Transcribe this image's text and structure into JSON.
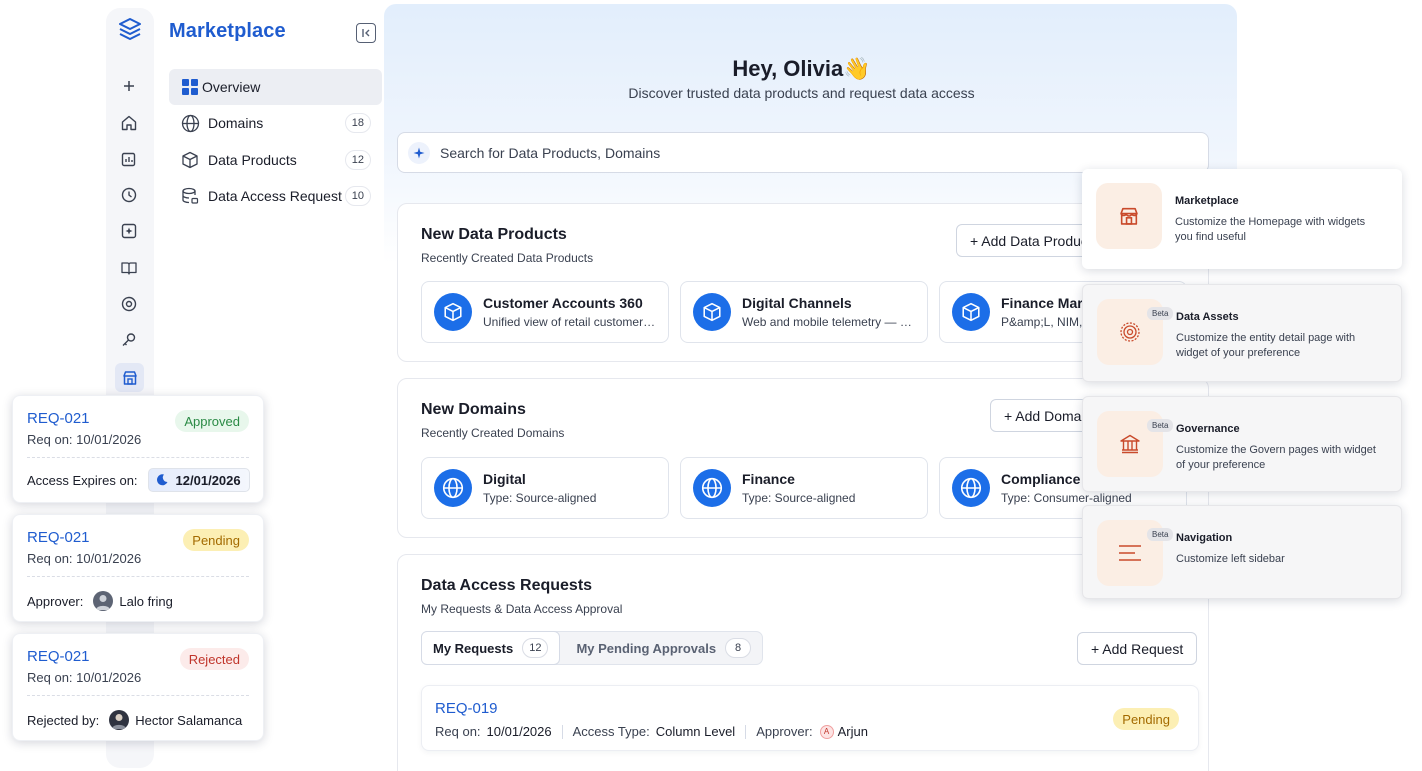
{
  "sidebar": {
    "title": "Marketplace",
    "items": [
      {
        "label": "Overview",
        "count": ""
      },
      {
        "label": "Domains",
        "count": "18"
      },
      {
        "label": "Data Products",
        "count": "12"
      },
      {
        "label": "Data Access Request",
        "count": "10"
      }
    ]
  },
  "rail_icons": [
    "add-icon",
    "home-icon",
    "insights-icon",
    "history-icon",
    "ai-icon",
    "glossary-icon",
    "governance-icon",
    "tools-icon",
    "marketplace-icon"
  ],
  "header": {
    "greeting": "Hey, Olivia",
    "wave": "👋",
    "subtitle": "Discover trusted data products and request data access"
  },
  "search": {
    "placeholder": "Search for Data Products, Domains"
  },
  "new_products": {
    "title": "New Data Products",
    "subtitle": "Recently Created Data Products",
    "button": "+ Add Data Products",
    "cards": [
      {
        "name": "Customer Accounts 360",
        "desc": "Unified view of retail customer accounts"
      },
      {
        "name": "Digital Channels",
        "desc": "Web and mobile telemetry — sessions"
      },
      {
        "name": "Finance Mart",
        "desc": "P&amp;L, NIM, fees"
      }
    ]
  },
  "new_domains": {
    "title": "New Domains",
    "subtitle": "Recently Created Domains",
    "button": "+ Add Domain",
    "cards": [
      {
        "name": "Digital",
        "desc": "Type: Source-aligned"
      },
      {
        "name": "Finance",
        "desc": "Type: Source-aligned"
      },
      {
        "name": "Compliance & Risk",
        "desc": "Type: Consumer-aligned"
      }
    ]
  },
  "access_requests": {
    "title": "Data Access Requests",
    "subtitle": "My Requests & Data Access Approval",
    "tabs": [
      {
        "label": "My Requests",
        "count": "12"
      },
      {
        "label": "My Pending Approvals",
        "count": "8"
      }
    ],
    "button": "+ Add Request",
    "row": {
      "id": "REQ-019",
      "req_on_label": "Req on:",
      "req_on": "10/01/2026",
      "access_type_label": "Access Type:",
      "access_type": "Column Level",
      "approver_label": "Approver:",
      "approver_initial": "A",
      "approver": "Arjun",
      "status": "Pending"
    }
  },
  "floating_requests": [
    {
      "id": "REQ-021",
      "status": "Approved",
      "req_on": "Req on:  10/01/2026",
      "foot_label": "Access Expires on:",
      "foot_value": "12/01/2026"
    },
    {
      "id": "REQ-021",
      "status": "Pending",
      "req_on": "Req on:  10/01/2026",
      "foot_label": "Approver:",
      "foot_value": "Lalo fring"
    },
    {
      "id": "REQ-021",
      "status": "Rejected",
      "req_on": "Req on:  10/01/2026",
      "foot_label": "Rejected by:",
      "foot_value": "Hector Salamanca"
    }
  ],
  "customize_panels": [
    {
      "title": "Marketplace",
      "desc": "Customize the Homepage with widgets you find useful",
      "beta": ""
    },
    {
      "title": "Data Assets",
      "desc": "Customize the entity detail page with widget of your preference",
      "beta": "Beta"
    },
    {
      "title": "Governance",
      "desc": "Customize the Govern pages with widget of your preference",
      "beta": "Beta"
    },
    {
      "title": "Navigation",
      "desc": "Customize left sidebar",
      "beta": "Beta"
    }
  ],
  "colors": {
    "accent": "#1f5ccf",
    "icon_circle": "#1c6ee8",
    "panel_icon": "#c94a2b"
  }
}
